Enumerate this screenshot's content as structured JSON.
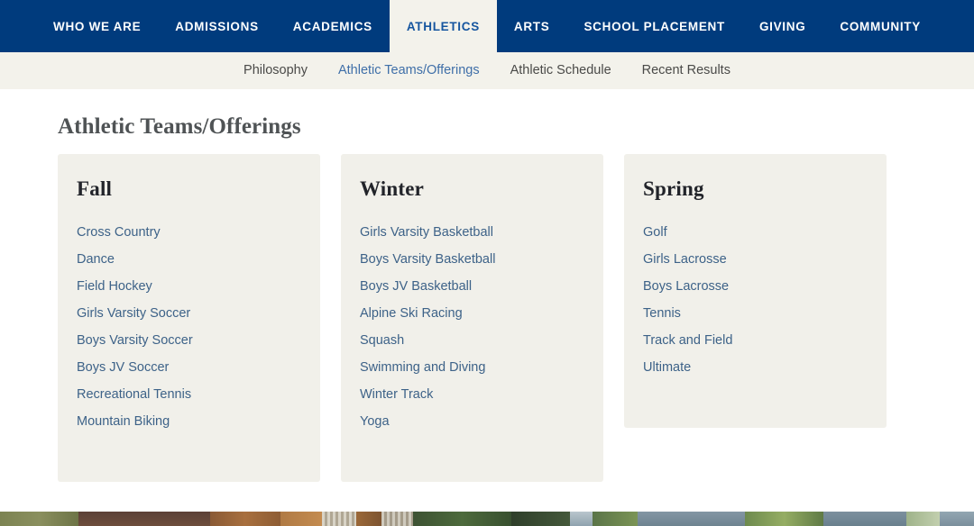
{
  "primary_nav": {
    "items": [
      {
        "label": "WHO WE ARE",
        "active": false
      },
      {
        "label": "ADMISSIONS",
        "active": false
      },
      {
        "label": "ACADEMICS",
        "active": false
      },
      {
        "label": "ATHLETICS",
        "active": true
      },
      {
        "label": "ARTS",
        "active": false
      },
      {
        "label": "SCHOOL PLACEMENT",
        "active": false
      },
      {
        "label": "GIVING",
        "active": false
      },
      {
        "label": "COMMUNITY",
        "active": false
      }
    ]
  },
  "secondary_nav": {
    "items": [
      {
        "label": "Philosophy",
        "active": false
      },
      {
        "label": "Athletic Teams/Offerings",
        "active": true
      },
      {
        "label": "Athletic Schedule",
        "active": false
      },
      {
        "label": "Recent Results",
        "active": false
      }
    ]
  },
  "main": {
    "page_title": "Athletic Teams/Offerings",
    "seasons": [
      {
        "title": "Fall",
        "teams": [
          "Cross Country",
          "Dance",
          "Field Hockey",
          "Girls Varsity Soccer",
          "Boys Varsity Soccer",
          "Boys JV Soccer",
          "Recreational Tennis",
          "Mountain Biking"
        ]
      },
      {
        "title": "Winter",
        "teams": [
          "Girls Varsity Basketball",
          "Boys Varsity Basketball",
          "Boys JV Basketball",
          "Alpine Ski Racing",
          "Squash",
          "Swimming and Diving",
          "Winter Track",
          "Yoga"
        ]
      },
      {
        "title": "Spring",
        "teams": [
          "Golf",
          "Girls Lacrosse",
          "Boys Lacrosse",
          "Tennis",
          "Track and Field",
          "Ultimate"
        ]
      }
    ]
  },
  "colors": {
    "nav_blue": "#003b7d",
    "active_tab_text": "#15559f",
    "cream": "#f3f2eb",
    "card_bg": "#f1f0ea",
    "link_blue": "#3d6288",
    "title_gray": "#4f5355",
    "secondary_nav_text": "#4a4a48"
  }
}
